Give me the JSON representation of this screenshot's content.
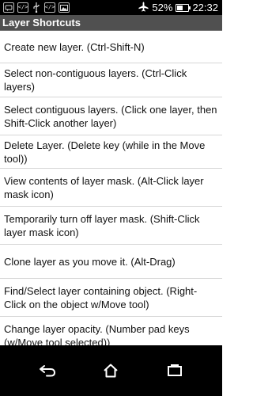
{
  "status_bar": {
    "battery_percent": "52%",
    "battery_level": 0.52,
    "time": "22:32",
    "left_icons": [
      "chat-icon",
      "code-icon",
      "usb-icon",
      "code-icon",
      "image-icon"
    ],
    "right_icons": [
      "airplane-icon",
      "battery-icon"
    ]
  },
  "app": {
    "title": "Layer Shortcuts"
  },
  "items": [
    {
      "text": "Create new layer. (Ctrl-Shift-N)"
    },
    {
      "text": "Select non-contiguous layers. (Ctrl-Click layers)"
    },
    {
      "text": "Select contiguous layers. (Click one layer, then Shift-Click another layer)"
    },
    {
      "text": "Delete Layer. (Delete key (while in the Move tool))"
    },
    {
      "text": "View contents of layer mask. (Alt-Click layer mask icon)"
    },
    {
      "text": "Temporarily turn off layer mask. (Shift-Click layer mask icon)"
    },
    {
      "text": "Clone layer as you move it. (Alt-Drag)"
    },
    {
      "text": "Find/Select layer containing object. (Right-Click on the object w/Move tool)"
    },
    {
      "text": "Change layer opacity. (Number pad keys (w/Move tool selected))"
    }
  ],
  "nav_bar": {
    "buttons": [
      "back-icon",
      "home-icon",
      "recent-apps-icon"
    ]
  }
}
